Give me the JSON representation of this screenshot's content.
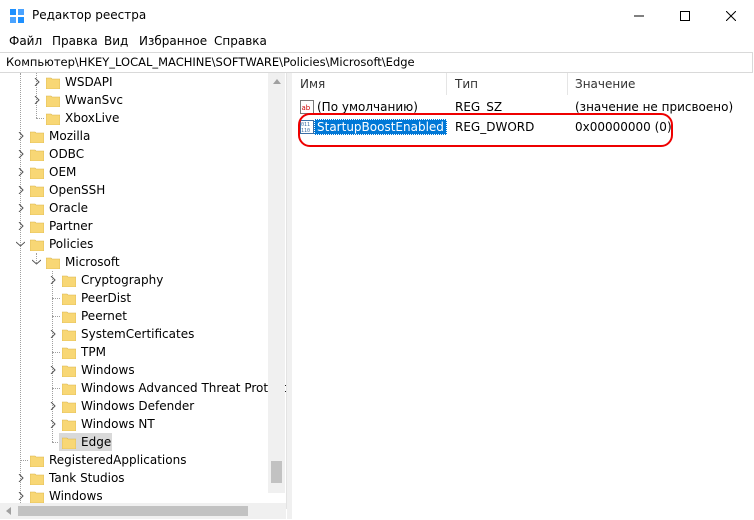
{
  "window": {
    "title": "Редактор реестра",
    "minimize_glyph": "—",
    "maximize_glyph": "☐",
    "close_glyph": "✕"
  },
  "menu": [
    "Файл",
    "Правка",
    "Вид",
    "Избранное",
    "Справка"
  ],
  "address_bar": "Компьютер\\HKEY_LOCAL_MACHINE\\SOFTWARE\\Policies\\Microsoft\\Edge",
  "tree": {
    "items": [
      {
        "label": "WSDAPI",
        "expandable": true
      },
      {
        "label": "WwanSvc",
        "expandable": true
      },
      {
        "label": "XboxLive",
        "expandable": false
      },
      {
        "label": "Mozilla",
        "expandable": true
      },
      {
        "label": "ODBC",
        "expandable": true
      },
      {
        "label": "OEM",
        "expandable": true
      },
      {
        "label": "OpenSSH",
        "expandable": true
      },
      {
        "label": "Oracle",
        "expandable": true
      },
      {
        "label": "Partner",
        "expandable": true
      },
      {
        "label": "Policies",
        "expandable": true,
        "expanded": true
      },
      {
        "label": "Microsoft",
        "expandable": true,
        "expanded": true
      },
      {
        "label": "Cryptography",
        "expandable": true
      },
      {
        "label": "PeerDist",
        "expandable": false
      },
      {
        "label": "Peernet",
        "expandable": false
      },
      {
        "label": "SystemCertificates",
        "expandable": true
      },
      {
        "label": "TPM",
        "expandable": false
      },
      {
        "label": "Windows",
        "expandable": true
      },
      {
        "label": "Windows Advanced Threat Protection",
        "expandable": false
      },
      {
        "label": "Windows Defender",
        "expandable": true
      },
      {
        "label": "Windows NT",
        "expandable": true
      },
      {
        "label": "Edge",
        "expandable": false,
        "selected": true
      },
      {
        "label": "RegisteredApplications",
        "expandable": false
      },
      {
        "label": "Tank Studios",
        "expandable": true
      },
      {
        "label": "Windows",
        "expandable": true
      }
    ]
  },
  "values_table": {
    "columns": [
      "Имя",
      "Тип",
      "Значение"
    ],
    "rows": [
      {
        "icon": "string-value-icon",
        "name": "(По умолчанию)",
        "type": "REG_SZ",
        "data": "(значение не присвоено)"
      },
      {
        "icon": "dword-value-icon",
        "name": "StartupBoostEnabled",
        "type": "REG_DWORD",
        "data": "0x00000000 (0)",
        "selected": true
      }
    ]
  },
  "colors": {
    "selection": "#0078d7",
    "highlight_annotation": "#e00000",
    "folder": "#f8d775"
  }
}
